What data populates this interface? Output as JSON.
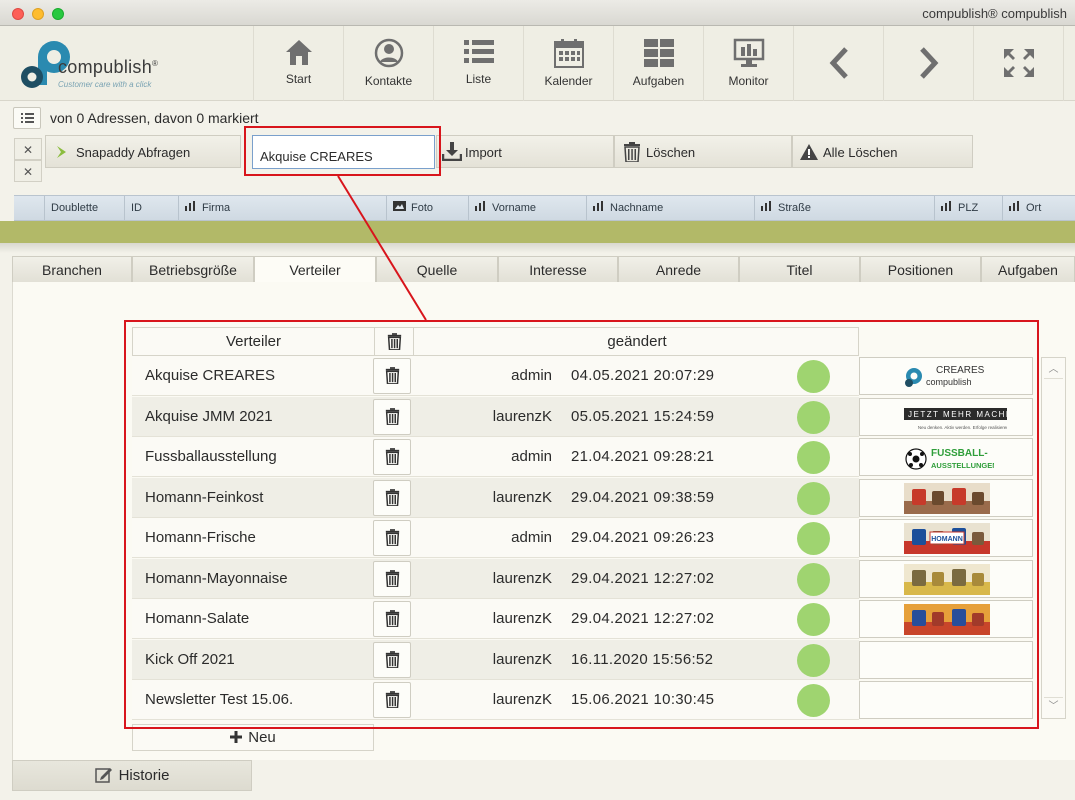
{
  "window": {
    "title": "compublish® compublish"
  },
  "logo": {
    "name": "compublish",
    "reg": "®",
    "tagline": "Customer care with a click"
  },
  "nav": [
    {
      "label": "Start",
      "icon": "home-icon"
    },
    {
      "label": "Kontakte",
      "icon": "contact-icon"
    },
    {
      "label": "Liste",
      "icon": "list-icon"
    },
    {
      "label": "Kalender",
      "icon": "calendar-icon"
    },
    {
      "label": "Aufgaben",
      "icon": "tasks-grid-icon"
    },
    {
      "label": "Monitor",
      "icon": "monitor-icon"
    },
    {
      "label": "",
      "icon": "chevron-left-icon"
    },
    {
      "label": "",
      "icon": "chevron-right-icon"
    },
    {
      "label": "",
      "icon": "fullscreen-icon"
    }
  ],
  "info": {
    "count_text": "von 0 Adressen, davon 0 markiert"
  },
  "actions": {
    "snapaddy": "Snapaddy Abfragen",
    "input_value": "Akquise CREARES",
    "import": "Import",
    "delete": "Löschen",
    "delete_all": "Alle Löschen"
  },
  "columns": [
    "Doublette",
    "ID",
    "Firma",
    "Foto",
    "Vorname",
    "Nachname",
    "Straße",
    "PLZ",
    "Ort"
  ],
  "tabs": [
    "Branchen",
    "Betriebsgröße",
    "Verteiler",
    "Quelle",
    "Interesse",
    "Anrede",
    "Titel",
    "Positionen",
    "Aufgaben"
  ],
  "active_tab": "Verteiler",
  "table": {
    "header_name": "Verteiler",
    "header_changed": "geändert",
    "rows": [
      {
        "name": "Akquise CREARES",
        "user": "admin",
        "date": "04.05.2021 20:07:29",
        "thumb": "creares"
      },
      {
        "name": "Akquise JMM 2021",
        "user": "laurenzK",
        "date": "05.05.2021 15:24:59",
        "thumb": "jmm"
      },
      {
        "name": "Fussballausstellung",
        "user": "admin",
        "date": "21.04.2021 09:28:21",
        "thumb": "fussball"
      },
      {
        "name": "Homann-Feinkost",
        "user": "laurenzK",
        "date": "29.04.2021 09:38:59",
        "thumb": "photo"
      },
      {
        "name": "Homann-Frische",
        "user": "admin",
        "date": "29.04.2021 09:26:23",
        "thumb": "photo"
      },
      {
        "name": "Homann-Mayonnaise",
        "user": "laurenzK",
        "date": "29.04.2021 12:27:02",
        "thumb": "photo"
      },
      {
        "name": "Homann-Salate",
        "user": "laurenzK",
        "date": "29.04.2021 12:27:02",
        "thumb": "photo"
      },
      {
        "name": "Kick Off 2021",
        "user": "laurenzK",
        "date": "16.11.2020 15:56:52",
        "thumb": ""
      },
      {
        "name": "Newsletter Test 15.06.",
        "user": "laurenzK",
        "date": "15.06.2021 10:30:45",
        "thumb": ""
      }
    ]
  },
  "thumbs": {
    "creares_title": "CREARES",
    "creares_sub": "compublish",
    "jmm_title": "JETZT MEHR MACHEN",
    "jmm_sub": "Neu denken. Aktiv werden. Erfolge realisieren.",
    "fussball_title": "FUSSBALL-",
    "fussball_sub": "AUSSTELLUNGEN",
    "homann_label": "HOMANN"
  },
  "new_button": "Neu",
  "historie": "Historie",
  "colors": {
    "accent_red": "#d8151c",
    "status_green": "#9fd470",
    "olive_bar": "#b2b968"
  }
}
